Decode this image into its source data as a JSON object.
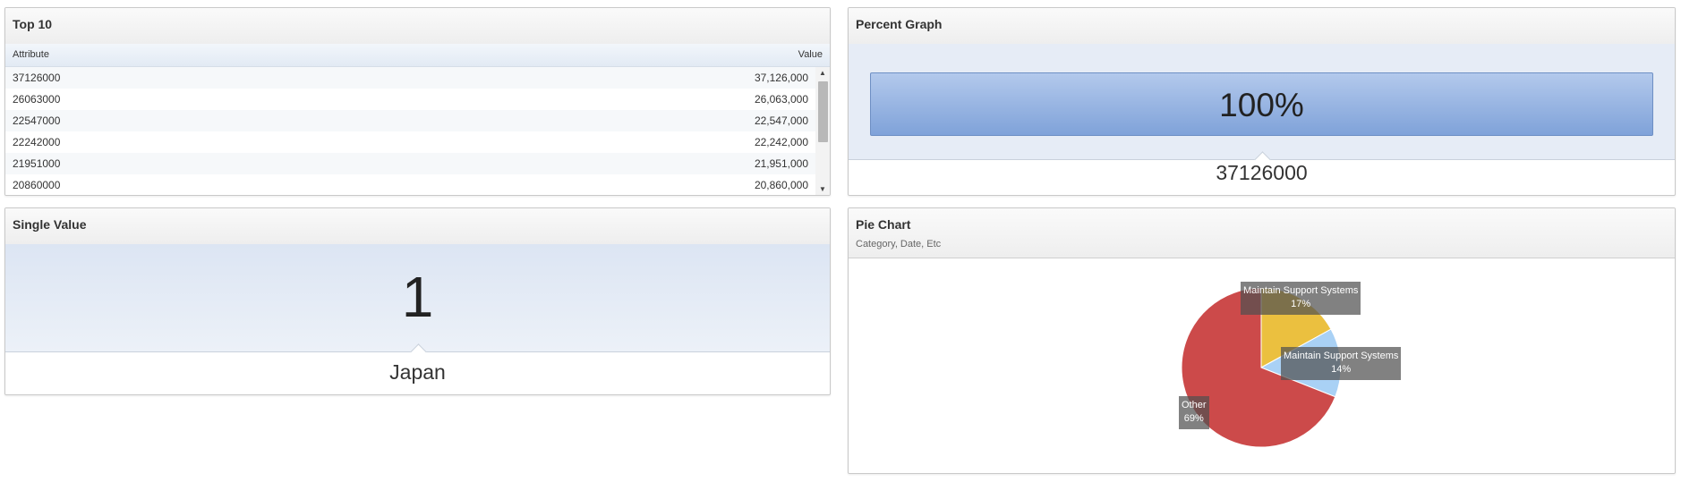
{
  "top10": {
    "title": "Top 10",
    "columns": {
      "attribute": "Attribute",
      "value": "Value"
    },
    "rows": [
      {
        "attribute": "37126000",
        "value": "37,126,000"
      },
      {
        "attribute": "26063000",
        "value": "26,063,000"
      },
      {
        "attribute": "22547000",
        "value": "22,547,000"
      },
      {
        "attribute": "22242000",
        "value": "22,242,000"
      },
      {
        "attribute": "21951000",
        "value": "21,951,000"
      },
      {
        "attribute": "20860000",
        "value": "20,860,000"
      }
    ]
  },
  "percent_graph": {
    "title": "Percent Graph",
    "percent_label": "100%",
    "percent_value": 1.0,
    "sub_value": "37126000",
    "colors": {
      "bar_top": "#b3c9ec",
      "bar_bottom": "#7fa2d9"
    }
  },
  "single_value": {
    "title": "Single Value",
    "value": "1",
    "label": "Japan"
  },
  "pie_chart": {
    "title": "Pie Chart",
    "subtitle": "Category, Date, Etc",
    "chart_data": {
      "type": "pie",
      "slices": [
        {
          "name": "Maintain Support Systems",
          "label": "Maintain Support Systems",
          "percent_label": "17%",
          "value": 17,
          "color": "#ebc03f"
        },
        {
          "name": "Maintain Support Systems",
          "label": "Maintain Support Systems",
          "percent_label": "14%",
          "value": 14,
          "color": "#a9d1f5"
        },
        {
          "name": "Other",
          "label": "Other",
          "percent_label": "69%",
          "value": 69,
          "color": "#cc4a4a"
        }
      ]
    }
  }
}
